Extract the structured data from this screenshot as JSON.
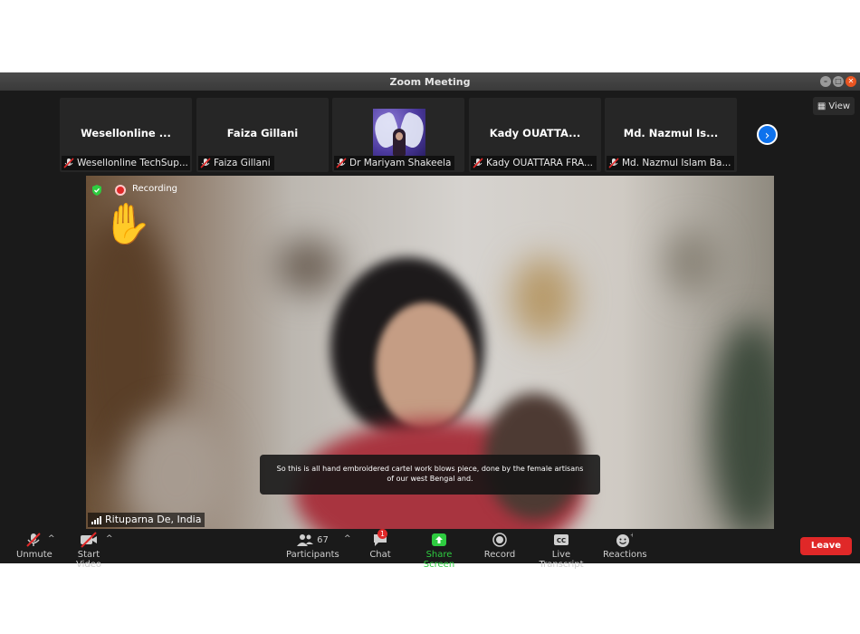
{
  "window": {
    "title": "Zoom Meeting"
  },
  "gallery": {
    "tiles": [
      {
        "name": "Wesellonline ...",
        "label": "Wesellonline TechSup..."
      },
      {
        "name": "Faiza Gillani",
        "label": "Faiza Gillani"
      },
      {
        "name": "",
        "label": "Dr Mariyam Shakeela"
      },
      {
        "name": "Kady OUATTA...",
        "label": "Kady OUATTARA FRA..."
      },
      {
        "name": "Md. Nazmul Is...",
        "label": "Md. Nazmul Islam Ba..."
      }
    ],
    "next_icon": "chevron-right-icon",
    "view_label": "View"
  },
  "main_video": {
    "recording_label": "Recording",
    "speaker_name": "Rituparna De, India",
    "caption": "So this is all hand embroidered cartel work blows piece, done by the female artisans of our west Bengal and.",
    "reaction": "raised-hand"
  },
  "toolbar": {
    "unmute": "Unmute",
    "start_video": "Start Video",
    "participants": "Participants",
    "participant_count": "67",
    "chat": "Chat",
    "chat_badge": "1",
    "share_screen": "Share Screen",
    "record": "Record",
    "live_transcript": "Live Transcript",
    "reactions": "Reactions",
    "leave": "Leave"
  },
  "colors": {
    "accent_blue": "#0e72ed",
    "share_green": "#2ecc40",
    "leave_red": "#e02828",
    "background": "#1a1a1a"
  }
}
